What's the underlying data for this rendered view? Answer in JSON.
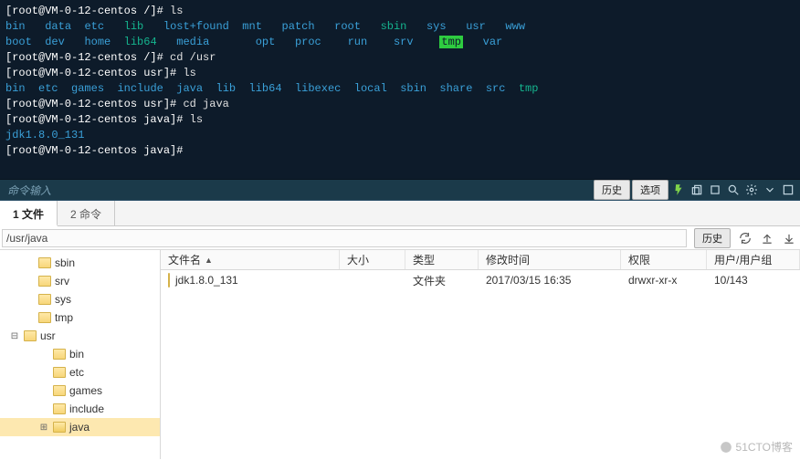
{
  "terminal": {
    "lines": [
      {
        "prompt": "[root@VM-0-12-centos /]# ",
        "cmd": "ls"
      },
      {
        "items": [
          {
            "t": "bin",
            "c": "dir"
          },
          {
            "t": "data",
            "c": "dir"
          },
          {
            "t": "etc",
            "c": "dir"
          },
          {
            "t": "lib",
            "c": "exe"
          },
          {
            "t": "lost+found",
            "c": "dir"
          },
          {
            "t": "mnt",
            "c": "dir"
          },
          {
            "t": "patch",
            "c": "dir"
          },
          {
            "t": "root",
            "c": "dir"
          },
          {
            "t": "sbin",
            "c": "exe"
          },
          {
            "t": "sys",
            "c": "dir"
          },
          {
            "t": "usr",
            "c": "dir"
          },
          {
            "t": "www",
            "c": "dir"
          }
        ]
      },
      {
        "items": [
          {
            "t": "boot",
            "c": "dir"
          },
          {
            "t": "dev",
            "c": "dir"
          },
          {
            "t": "home",
            "c": "dir"
          },
          {
            "t": "lib64",
            "c": "exe"
          },
          {
            "t": "media",
            "c": "dir"
          },
          {
            "t": "opt",
            "c": "dir"
          },
          {
            "t": "proc",
            "c": "dir"
          },
          {
            "t": "run",
            "c": "dir"
          },
          {
            "t": "srv",
            "c": "dir"
          },
          {
            "t": "tmp",
            "c": "hl"
          },
          {
            "t": "var",
            "c": "dir"
          }
        ],
        "widths": "row2"
      },
      {
        "prompt": "[root@VM-0-12-centos /]# ",
        "cmd": "cd /usr"
      },
      {
        "prompt": "[root@VM-0-12-centos usr]# ",
        "cmd": "ls"
      },
      {
        "items": [
          {
            "t": "bin",
            "c": "dir"
          },
          {
            "t": "etc",
            "c": "dir"
          },
          {
            "t": "games",
            "c": "dir"
          },
          {
            "t": "include",
            "c": "dir"
          },
          {
            "t": "java",
            "c": "dir"
          },
          {
            "t": "lib",
            "c": "dir"
          },
          {
            "t": "lib64",
            "c": "dir"
          },
          {
            "t": "libexec",
            "c": "dir"
          },
          {
            "t": "local",
            "c": "dir"
          },
          {
            "t": "sbin",
            "c": "dir"
          },
          {
            "t": "share",
            "c": "dir"
          },
          {
            "t": "src",
            "c": "dir"
          },
          {
            "t": "tmp",
            "c": "exe"
          }
        ],
        "widths": "row3"
      },
      {
        "prompt": "[root@VM-0-12-centos usr]# ",
        "cmd": "cd java"
      },
      {
        "prompt": "[root@VM-0-12-centos java]# ",
        "cmd": "ls"
      },
      {
        "items": [
          {
            "t": "jdk1.8.0_131",
            "c": "dir"
          }
        ]
      },
      {
        "prompt": "[root@VM-0-12-centos java]# ",
        "cmd": ""
      }
    ]
  },
  "cmdbar": {
    "placeholder": "命令输入",
    "history": "历史",
    "options": "选项"
  },
  "tabs": {
    "files": "1 文件",
    "commands": "2 命令"
  },
  "path": "/usr/java",
  "path_history": "历史",
  "tree": [
    {
      "depth": 1,
      "toggle": "",
      "name": "sbin"
    },
    {
      "depth": 1,
      "toggle": "",
      "name": "srv"
    },
    {
      "depth": 1,
      "toggle": "",
      "name": "sys"
    },
    {
      "depth": 1,
      "toggle": "",
      "name": "tmp"
    },
    {
      "depth": 0,
      "toggle": "⊟",
      "name": "usr"
    },
    {
      "depth": 2,
      "toggle": "",
      "name": "bin"
    },
    {
      "depth": 2,
      "toggle": "",
      "name": "etc"
    },
    {
      "depth": 2,
      "toggle": "",
      "name": "games"
    },
    {
      "depth": 2,
      "toggle": "",
      "name": "include"
    },
    {
      "depth": 2,
      "toggle": "⊞",
      "name": "java",
      "selected": true,
      "open": true
    }
  ],
  "columns": {
    "name": "文件名",
    "size": "大小",
    "type": "类型",
    "mtime": "修改时间",
    "perm": "权限",
    "owner": "用户/用户组"
  },
  "rows": [
    {
      "name": "jdk1.8.0_131",
      "size": "",
      "type": "文件夹",
      "mtime": "2017/03/15 16:35",
      "perm": "drwxr-xr-x",
      "owner": "10/143"
    }
  ],
  "watermark": "51CTO博客"
}
